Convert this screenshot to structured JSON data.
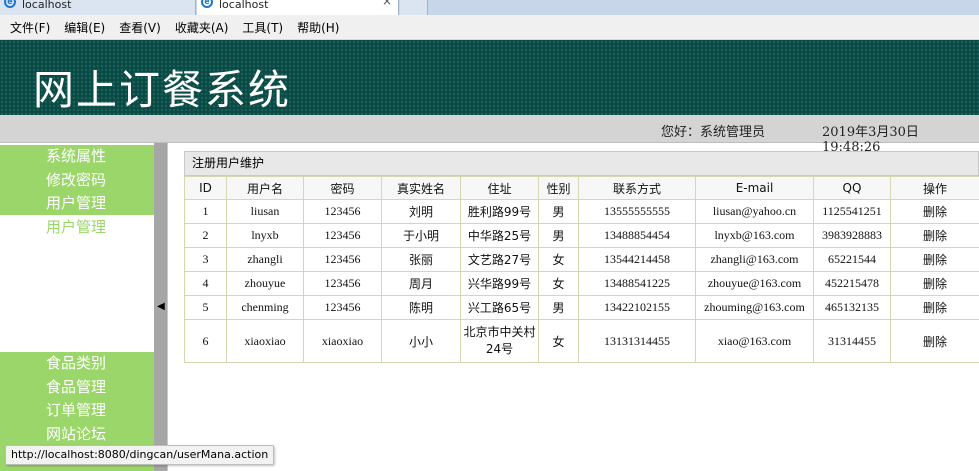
{
  "browser": {
    "tabs": [
      {
        "title": "localhost"
      },
      {
        "title": "localhost",
        "close_glyph": "×"
      },
      {
        "title": ""
      }
    ],
    "menu": [
      "文件(F)",
      "编辑(E)",
      "查看(V)",
      "收藏夹(A)",
      "工具(T)",
      "帮助(H)"
    ],
    "status_url": "http://localhost:8080/dingcan/userMana.action"
  },
  "app": {
    "title": "网上订餐系统",
    "greeting": "您好：系统管理员",
    "datetime": "2019年3月30日 19:48:26",
    "colors": {
      "banner": "#0b4a45",
      "sidebar": "#9bd66a",
      "table_border": "#d6d6b0"
    }
  },
  "sidebar": {
    "group1": [
      "系统属性",
      "修改密码",
      "用户管理"
    ],
    "loose": "用户管理",
    "group2": [
      "食品类别",
      "食品管理",
      "订单管理",
      "网站论坛"
    ]
  },
  "panel": {
    "title": "注册用户维护",
    "columns": [
      "ID",
      "用户名",
      "密码",
      "真实姓名",
      "住址",
      "性别",
      "联系方式",
      "E-mail",
      "QQ",
      "操作"
    ],
    "rows": [
      [
        "1",
        "liusan",
        "123456",
        "刘明",
        "胜利路99号",
        "男",
        "13555555555",
        "liusan@yahoo.cn",
        "1125541251",
        "删除"
      ],
      [
        "2",
        "lnyxb",
        "123456",
        "于小明",
        "中华路25号",
        "男",
        "13488854454",
        "lnyxb@163.com",
        "3983928883",
        "删除"
      ],
      [
        "3",
        "zhangli",
        "123456",
        "张丽",
        "文艺路27号",
        "女",
        "13544214458",
        "zhangli@163.com",
        "65221544",
        "删除"
      ],
      [
        "4",
        "zhouyue",
        "123456",
        "周月",
        "兴华路99号",
        "女",
        "13488541225",
        "zhouyue@163.com",
        "452215478",
        "删除"
      ],
      [
        "5",
        "chenming",
        "123456",
        "陈明",
        "兴工路65号",
        "男",
        "13422102155",
        "zhouming@163.com",
        "465132135",
        "删除"
      ],
      [
        "6",
        "xiaoxiao",
        "xiaoxiao",
        "小小",
        "北京市中关村24号",
        "女",
        "13131314455",
        "xiao@163.com",
        "31314455",
        "删除"
      ]
    ]
  },
  "icons": {
    "browser_tab": "ie-icon",
    "splitter": "collapse-left-arrow-icon"
  }
}
